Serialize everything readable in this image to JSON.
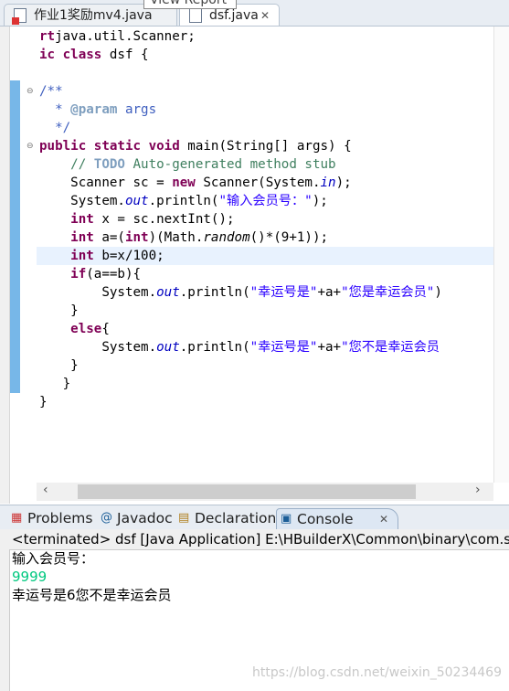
{
  "editor_tabs": [
    {
      "label": "作业1奖励mv4.java",
      "icon": "java-file-error-icon"
    },
    {
      "label": "dsf.java",
      "icon": "java-file-icon",
      "active": true
    }
  ],
  "tooltip": "View Report",
  "code_lines": [
    [
      [
        "kw",
        "rt"
      ],
      [
        "",
        "java.util.Scanner;"
      ]
    ],
    [
      [
        "kw",
        "ic class"
      ],
      [
        "",
        " dsf {"
      ]
    ],
    [],
    [
      [
        "jd",
        "/**"
      ]
    ],
    [
      [
        "jd",
        "  * "
      ],
      [
        "tag",
        "@param"
      ],
      [
        "jd",
        " args"
      ]
    ],
    [
      [
        "jd",
        "  */"
      ]
    ],
    [
      [
        "kw",
        "public static void"
      ],
      [
        "",
        " main(String[] args) {"
      ]
    ],
    [
      [
        "cm",
        "    // "
      ],
      [
        "todo",
        "TODO"
      ],
      [
        "cm",
        " Auto-generated method stub"
      ]
    ],
    [
      [
        "",
        "    Scanner sc = "
      ],
      [
        "kw",
        "new"
      ],
      [
        "",
        " Scanner(System."
      ],
      [
        "fi",
        "in"
      ],
      [
        "",
        ");"
      ]
    ],
    [
      [
        "",
        "    System."
      ],
      [
        "fi",
        "out"
      ],
      [
        "",
        ".println("
      ],
      [
        "st",
        "\"输入会员号：\""
      ],
      [
        "",
        ");"
      ]
    ],
    [
      [
        "kw",
        "    int"
      ],
      [
        "",
        " x = sc.nextInt();"
      ]
    ],
    [
      [
        "kw",
        "    int"
      ],
      [
        "",
        " a=("
      ],
      [
        "kw",
        "int"
      ],
      [
        "",
        ")(Math."
      ],
      [
        "it",
        "random"
      ],
      [
        "",
        "()*(9+1));"
      ]
    ],
    [
      [
        "kw",
        "    int"
      ],
      [
        "",
        " b=x/100;"
      ]
    ],
    [
      [
        "kw",
        "    if"
      ],
      [
        "",
        "(a==b){"
      ]
    ],
    [
      [
        "",
        "        System."
      ],
      [
        "fi",
        "out"
      ],
      [
        "",
        ".println("
      ],
      [
        "st",
        "\"幸运号是\""
      ],
      [
        "",
        "+a+"
      ],
      [
        "st",
        "\"您是幸运会员\""
      ],
      [
        "",
        ")"
      ]
    ],
    [
      [
        "",
        "    }"
      ]
    ],
    [
      [
        "kw",
        "    else"
      ],
      [
        "",
        "{"
      ]
    ],
    [
      [
        "",
        "        System."
      ],
      [
        "fi",
        "out"
      ],
      [
        "",
        ".println("
      ],
      [
        "st",
        "\"幸运号是\""
      ],
      [
        "",
        "+a+"
      ],
      [
        "st",
        "\"您不是幸运会员"
      ]
    ],
    [
      [
        "",
        "    }"
      ]
    ],
    [
      [
        "",
        "   }"
      ]
    ],
    [
      [
        "",
        "}"
      ]
    ]
  ],
  "bottom_tabs": [
    {
      "label": "Problems",
      "icon": "problems-icon"
    },
    {
      "label": "Javadoc",
      "icon": "at-icon"
    },
    {
      "label": "Declaration",
      "icon": "declaration-icon"
    },
    {
      "label": "Console",
      "icon": "console-icon",
      "active": true
    }
  ],
  "console": {
    "header": "<terminated> dsf [Java Application] E:\\HBuilderX\\Common\\binary\\com.sun",
    "output": [
      {
        "text": "输入会员号：",
        "color": "#000000"
      },
      {
        "text": "9999",
        "color": "#00c87f"
      },
      {
        "text": "幸运号是6您不是幸运会员",
        "color": "#000000"
      }
    ]
  },
  "watermark": "https://blog.csdn.net/weixin_50234469"
}
